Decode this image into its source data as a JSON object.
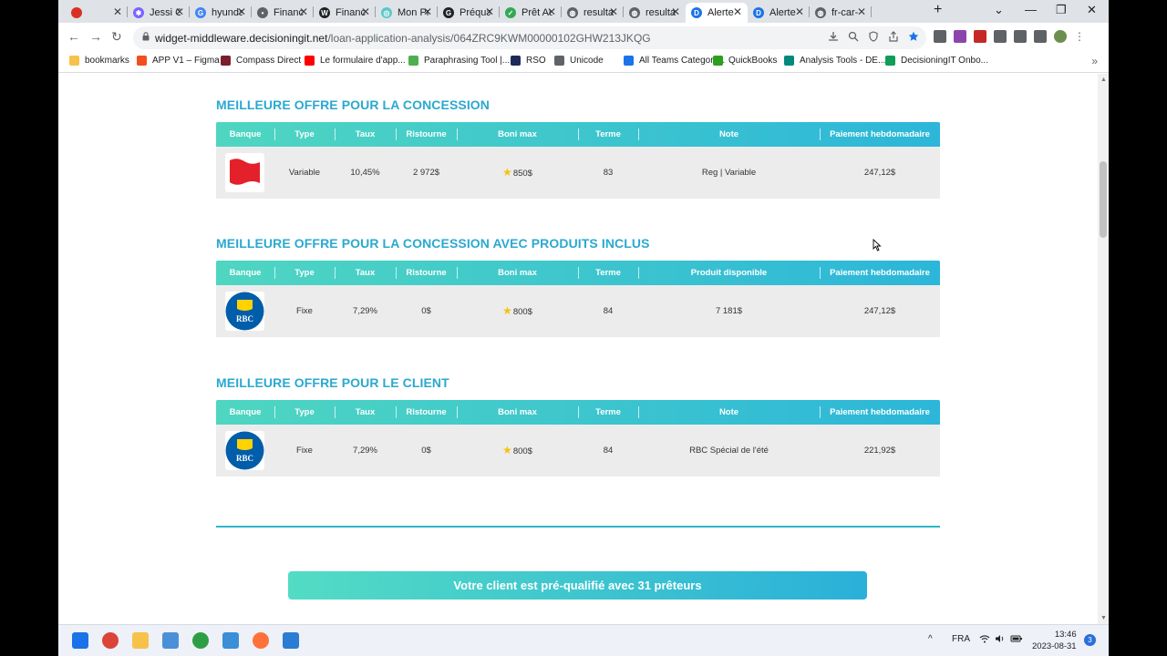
{
  "browser": {
    "tabs": [
      {
        "title": "",
        "color": "#d93025",
        "glyph": ""
      },
      {
        "title": "Jessi Ca",
        "color": "#7b61ff",
        "glyph": "✱"
      },
      {
        "title": "hyunda",
        "color": "#4285f4",
        "glyph": "G"
      },
      {
        "title": "Financ",
        "color": "#5f6368",
        "glyph": "•"
      },
      {
        "title": "Financ",
        "color": "#202124",
        "glyph": "W"
      },
      {
        "title": "Mon Pr",
        "color": "#5ac8c8",
        "glyph": "◎"
      },
      {
        "title": "Préqua",
        "color": "#202124",
        "glyph": "G"
      },
      {
        "title": "Prêt Au",
        "color": "#34a853",
        "glyph": "✓"
      },
      {
        "title": "resulta",
        "color": "#5f6368",
        "glyph": "◍"
      },
      {
        "title": "resulta",
        "color": "#5f6368",
        "glyph": "◍"
      },
      {
        "title": "Alerte",
        "color": "#1a73e8",
        "glyph": "D"
      },
      {
        "title": "Alerte",
        "color": "#1a73e8",
        "glyph": "D"
      },
      {
        "title": "fr-car-",
        "color": "#5f6368",
        "glyph": "◍"
      }
    ],
    "active_tab_index": 10,
    "close_glyph": "✕",
    "new_tab_glyph": "+",
    "window_controls": {
      "menu": "⌄",
      "minimize": "—",
      "restore": "❐",
      "close": "✕"
    },
    "nav": {
      "back": "←",
      "forward": "→",
      "reload": "↻"
    },
    "url_domain": "widget-middleware.decisioningit.net",
    "url_path": "/loan-application-analysis/064ZRC9KWM00000102GHW213JKQG",
    "omnibox_icons": [
      "download-icon",
      "zoom-icon",
      "shield-icon",
      "share-icon",
      "bookmark-star-icon"
    ],
    "extensions": [
      {
        "name": "camera-extension-icon",
        "color": "#5f6368"
      },
      {
        "name": "puzzle-color-extension-icon",
        "color": "#8e44ad"
      },
      {
        "name": "pdf-extension-icon",
        "color": "#c62828"
      },
      {
        "name": "extensions-puzzle-icon",
        "color": "#5f6368"
      },
      {
        "name": "reading-list-icon",
        "color": "#5f6368"
      },
      {
        "name": "side-panel-icon",
        "color": "#5f6368"
      },
      {
        "name": "profile-avatar-icon",
        "color": "#6d8f4e"
      },
      {
        "name": "kebab-menu-icon",
        "color": "#5f6368"
      }
    ]
  },
  "bookmarks": [
    {
      "label": "bookmarks",
      "color": "#f6c24a"
    },
    {
      "label": "APP V1 – Figma",
      "color": "#f24e1e"
    },
    {
      "label": "Compass Direct",
      "color": "#7a1f2b"
    },
    {
      "label": "Le formulaire d'app...",
      "color": "#ff0000"
    },
    {
      "label": "Paraphrasing Tool |...",
      "color": "#4caf50"
    },
    {
      "label": "RSO",
      "color": "#1e2a5a"
    },
    {
      "label": "Unicode",
      "color": "#5f6368"
    },
    {
      "label": "All Teams Category...",
      "color": "#1a73e8"
    },
    {
      "label": "QuickBooks",
      "color": "#2ca01c"
    },
    {
      "label": "Analysis Tools - DE...",
      "color": "#00897b"
    },
    {
      "label": "DecisioningIT Onbo...",
      "color": "#0f9d58"
    }
  ],
  "bookmarks_more": "»",
  "sections": [
    {
      "title": "MEILLEURE OFFRE POUR LA CONCESSION",
      "headers": [
        "Banque",
        "Type",
        "Taux",
        "Ristourne",
        "Boni max",
        "Terme",
        "Note",
        "Paiement hebdomadaire"
      ],
      "row": {
        "bank": "national-bank-logo",
        "type": "Variable",
        "rate": "10,45%",
        "rebate": "2 972$",
        "bonus": "850$",
        "term": "83",
        "note": "Reg | Variable",
        "payment": "247,12$"
      }
    },
    {
      "title": "MEILLEURE OFFRE POUR LA CONCESSION AVEC PRODUITS INCLUS",
      "headers": [
        "Banque",
        "Type",
        "Taux",
        "Ristourne",
        "Boni max",
        "Terme",
        "Produit disponible",
        "Paiement hebdomadaire"
      ],
      "row": {
        "bank": "rbc-logo",
        "type": "Fixe",
        "rate": "7,29%",
        "rebate": "0$",
        "bonus": "800$",
        "term": "84",
        "note": "7 181$",
        "payment": "247,12$"
      }
    },
    {
      "title": "MEILLEURE OFFRE POUR LE CLIENT",
      "headers": [
        "Banque",
        "Type",
        "Taux",
        "Ristourne",
        "Boni max",
        "Terme",
        "Note",
        "Paiement hebdomadaire"
      ],
      "row": {
        "bank": "rbc-logo",
        "type": "Fixe",
        "rate": "7,29%",
        "rebate": "0$",
        "bonus": "800$",
        "term": "84",
        "note": "RBC Spécial de l'été",
        "payment": "221,92$"
      }
    }
  ],
  "rbc_logo_text": "RBC",
  "star_glyph": "★",
  "cta_label": "Votre client est pré-qualifié avec 31 prêteurs",
  "taskbar": {
    "apps": [
      {
        "name": "windows-start-icon",
        "color": "#1a73e8"
      },
      {
        "name": "chrome-icon",
        "color": "#db4437"
      },
      {
        "name": "file-explorer-icon",
        "color": "#f6c24a"
      },
      {
        "name": "notepad-icon",
        "color": "#4a90d9"
      },
      {
        "name": "xbox-app-icon",
        "color": "#2e9e44"
      },
      {
        "name": "snipping-tool-icon",
        "color": "#3b8fd6"
      },
      {
        "name": "firefox-icon",
        "color": "#ff7139"
      },
      {
        "name": "paint-icon",
        "color": "#2b7cd3"
      }
    ],
    "tray_chevron": "^",
    "language": "FRA",
    "time": "13:46",
    "date": "2023-08-31",
    "notifications": "3"
  }
}
